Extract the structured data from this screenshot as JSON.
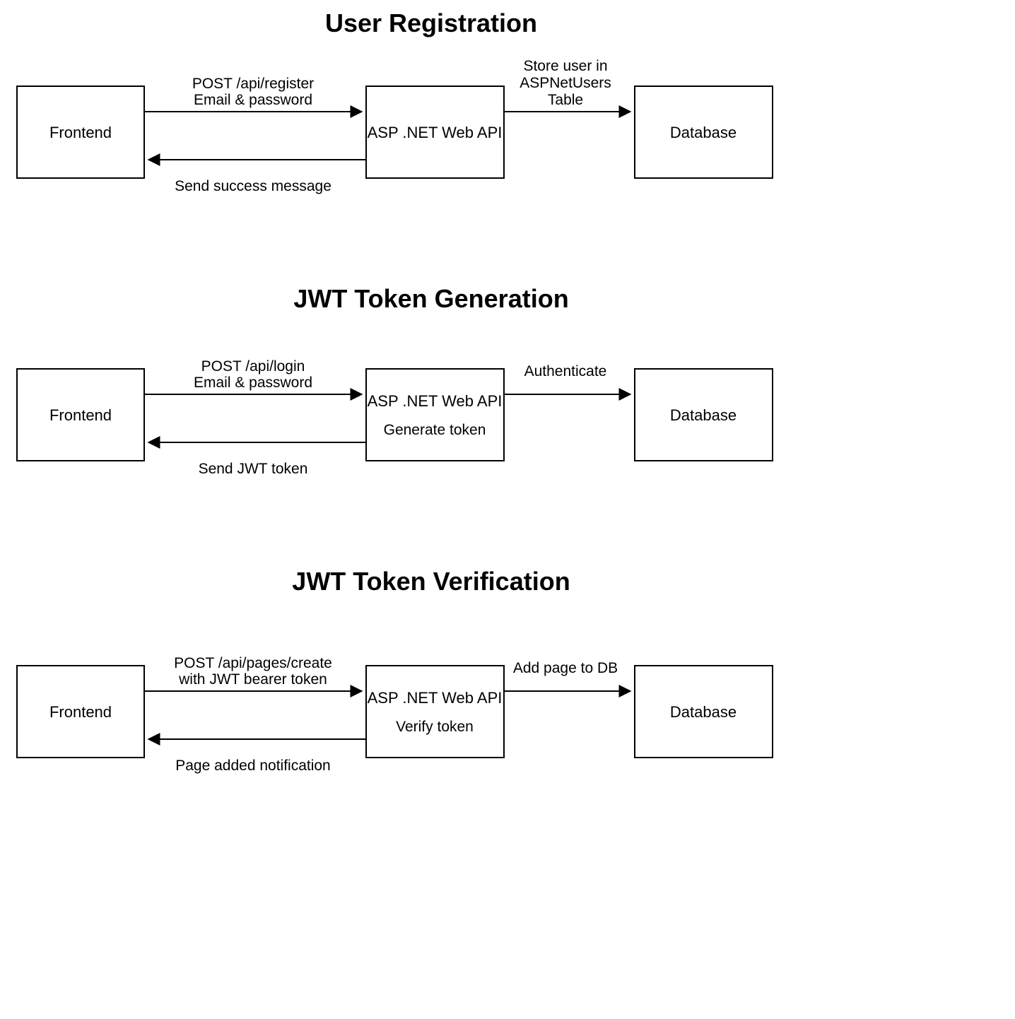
{
  "sections": {
    "registration": {
      "title": "User Registration",
      "frontend": "Frontend",
      "api": "ASP .NET Web API",
      "api_sub": "",
      "db": "Database",
      "req_line1": "POST /api/register",
      "req_line2": "Email & password",
      "resp": "Send success message",
      "db_arrow_line1": "Store user in",
      "db_arrow_line2": "ASPNetUsers",
      "db_arrow_line3": "Table"
    },
    "jwt_gen": {
      "title": "JWT Token Generation",
      "frontend": "Frontend",
      "api": "ASP .NET Web API",
      "api_sub": "Generate token",
      "db": "Database",
      "req_line1": "POST /api/login",
      "req_line2": "Email & password",
      "resp": "Send JWT token",
      "db_arrow_line1": "Authenticate",
      "db_arrow_line2": "",
      "db_arrow_line3": ""
    },
    "jwt_verify": {
      "title": "JWT Token Verification",
      "frontend": "Frontend",
      "api": "ASP .NET Web API",
      "api_sub": "Verify token",
      "db": "Database",
      "req_line1": "POST /api/pages/create",
      "req_line2": "with JWT bearer token",
      "resp": "Page added notification",
      "db_arrow_line1": "Add page to DB",
      "db_arrow_line2": "",
      "db_arrow_line3": ""
    }
  }
}
